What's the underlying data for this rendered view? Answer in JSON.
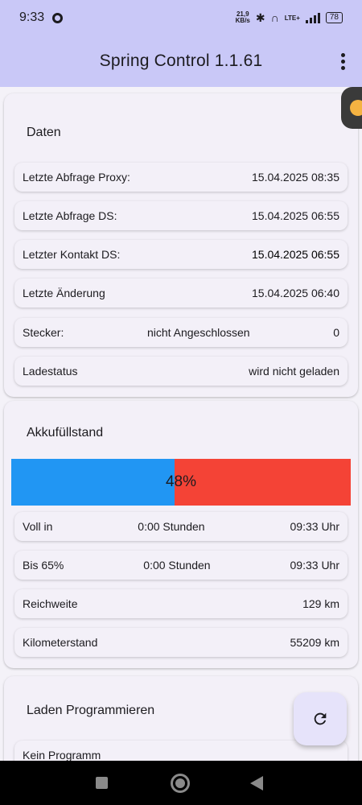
{
  "status": {
    "time": "9:33",
    "net_speed_value": "21,9",
    "net_speed_unit": "KB/s",
    "network": "LTE+",
    "battery": "78"
  },
  "appbar": {
    "title": "Spring Control 1.1.61"
  },
  "daten": {
    "title": "Daten",
    "rows": [
      {
        "label": "Letzte Abfrage Proxy:",
        "middle": "",
        "value": "15.04.2025 08:35"
      },
      {
        "label": "Letzte Abfrage DS:",
        "middle": "",
        "value": "15.04.2025 06:55"
      },
      {
        "label": "Letzter Kontakt DS:",
        "middle": "",
        "value": "15.04.2025 06:55"
      },
      {
        "label": "Letzte Änderung",
        "middle": "",
        "value": "15.04.2025 06:40"
      },
      {
        "label": "Stecker:",
        "middle": "nicht Angeschlossen",
        "value": "0"
      },
      {
        "label": "Ladestatus",
        "middle": "",
        "value": "wird nicht geladen"
      }
    ]
  },
  "akku": {
    "title": "Akkufüllstand",
    "percent_label": "48%",
    "level": 0.48,
    "colors": {
      "filled": "#2196f3",
      "empty": "#f44336"
    },
    "rows": [
      {
        "label": "Voll in",
        "middle": "0:00 Stunden",
        "value": "09:33 Uhr"
      },
      {
        "label": "Bis 65%",
        "middle": "0:00 Stunden",
        "value": "09:33 Uhr"
      },
      {
        "label": "Reichweite",
        "middle": "",
        "value": "129 km"
      },
      {
        "label": "Kilometerstand",
        "middle": "",
        "value": "55209 km"
      }
    ]
  },
  "laden": {
    "title": "Laden Programmieren",
    "first_row": "Kein Programm"
  },
  "icons": {
    "menu": "more-vert-icon",
    "refresh": "refresh-icon",
    "nav_recent": "square-icon",
    "nav_home": "circle-icon",
    "nav_back": "triangle-back-icon"
  }
}
